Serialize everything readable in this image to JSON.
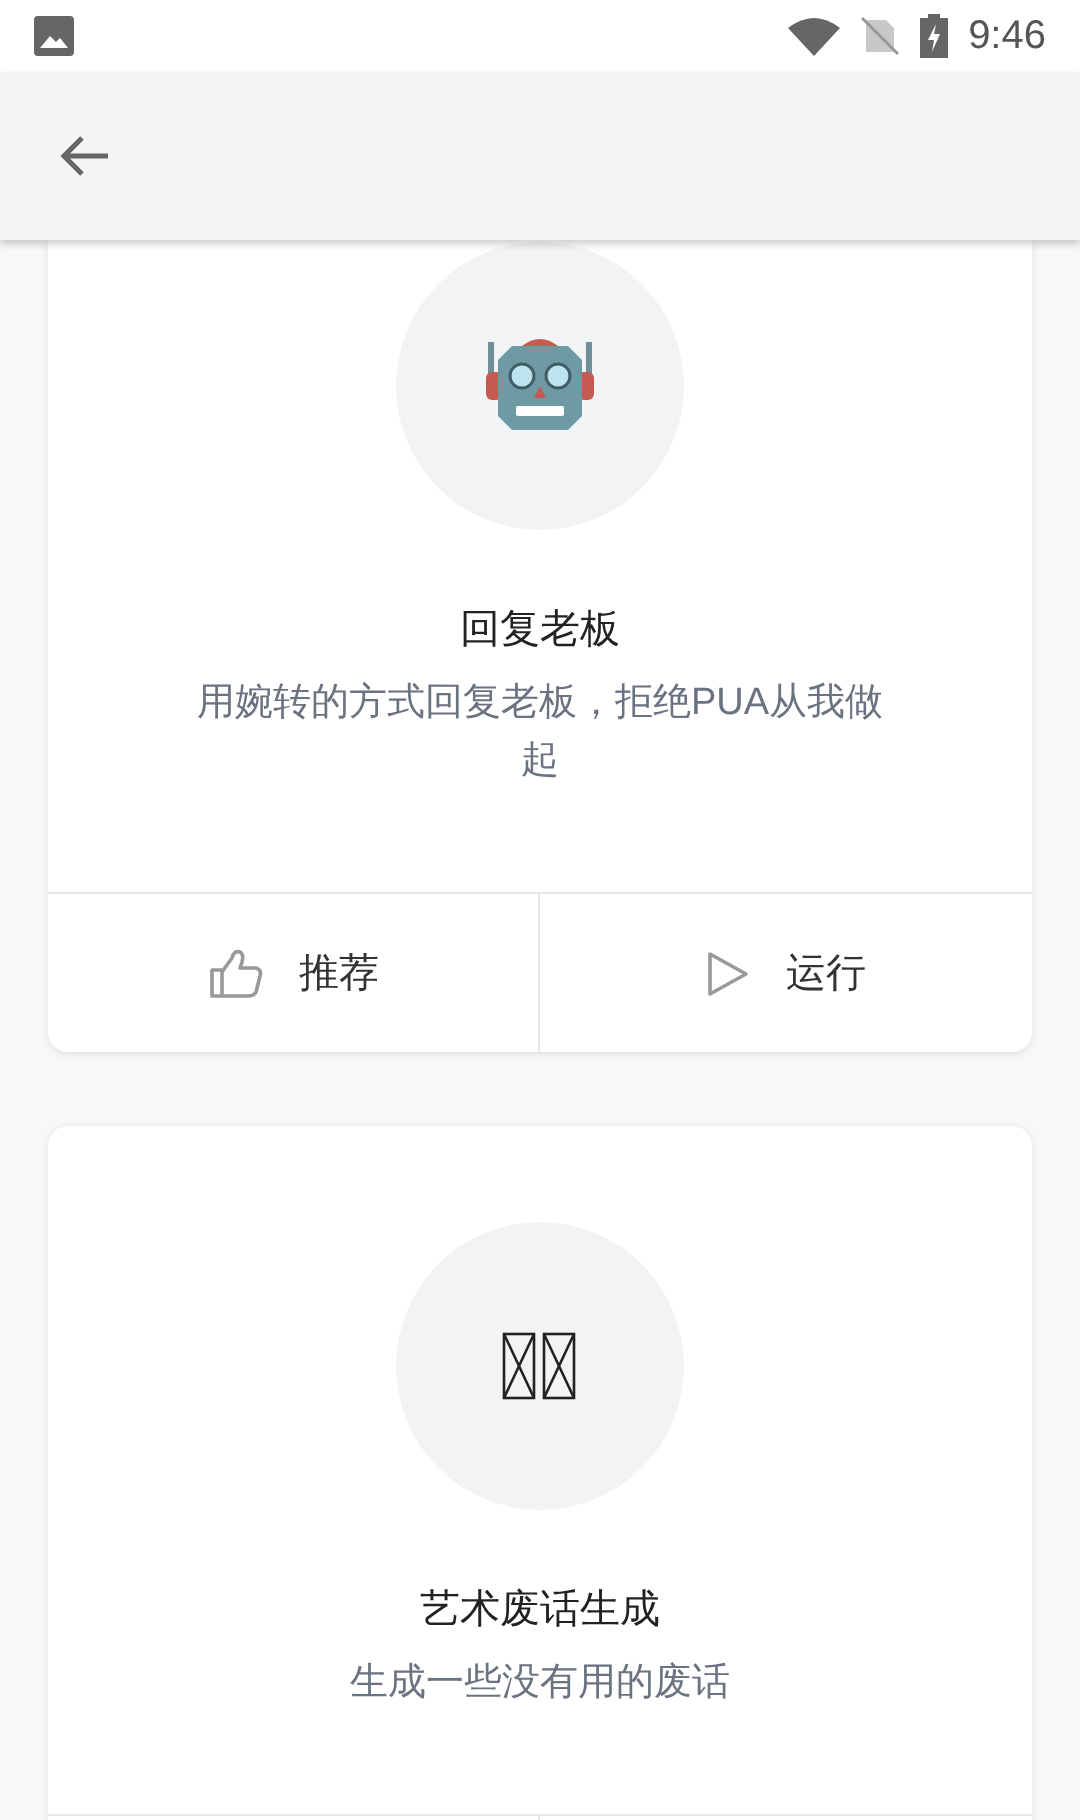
{
  "status_bar": {
    "time": "9:46"
  },
  "cards": [
    {
      "kind": "robot",
      "title": "回复老板",
      "description": "用婉转的方式回复老板，拒绝PUA从我做起",
      "actions": [
        {
          "kind": "like",
          "label": "推荐"
        },
        {
          "kind": "run",
          "label": "运行"
        }
      ]
    },
    {
      "kind": "missing_glyph",
      "title": "艺术废话生成",
      "description": "生成一些没有用的废话"
    }
  ]
}
